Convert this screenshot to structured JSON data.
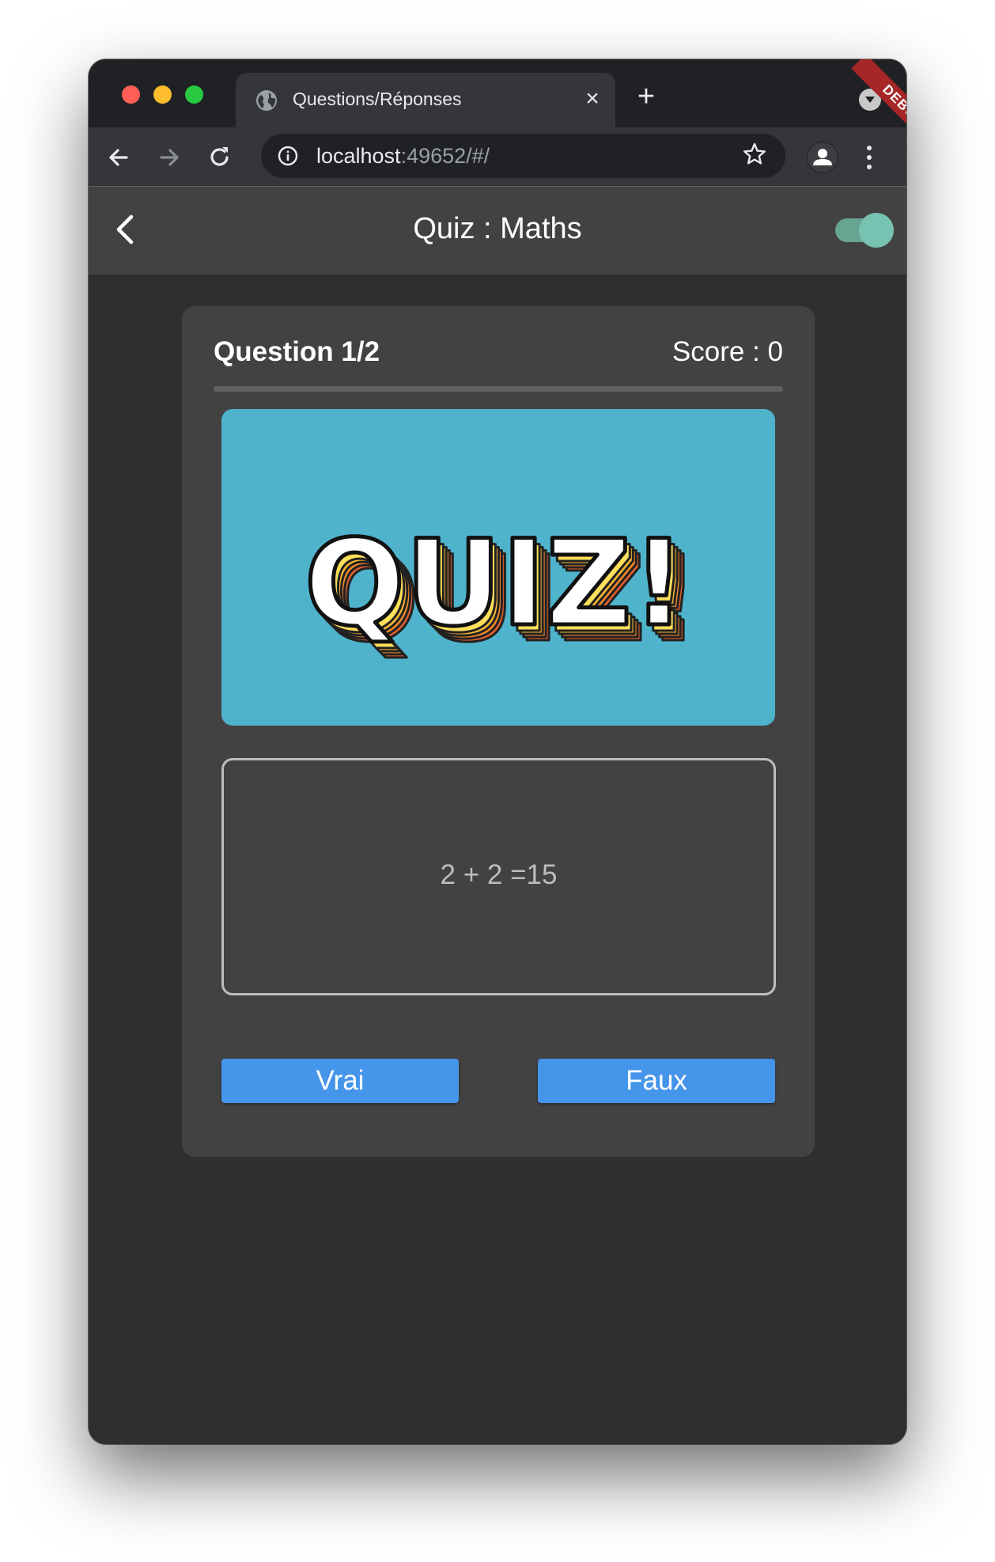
{
  "browser": {
    "tab_title": "Questions/Réponses",
    "url_host": "localhost",
    "url_rest": ":49652/#/",
    "icons": [
      "globe-icon",
      "close-icon",
      "plus-icon",
      "chevron-down-icon",
      "back-arrow-icon",
      "forward-arrow-icon",
      "reload-icon",
      "info-icon",
      "star-icon",
      "profile-icon",
      "kebab-menu-icon"
    ]
  },
  "appbar": {
    "title": "Quiz : Maths",
    "debug_banner": "DEBUG"
  },
  "quiz": {
    "question_label": "Question 1/2",
    "score_label": "Score : 0",
    "progress": 0,
    "image_text": "QUIZ!",
    "question_text": "2 + 2 =15",
    "answers": {
      "true_label": "Vrai",
      "false_label": "Faux"
    }
  },
  "colors": {
    "app_bar": "#424242",
    "background": "#2f2f2f",
    "button": "#4595ea",
    "image_bg": "#4fb3cc"
  }
}
